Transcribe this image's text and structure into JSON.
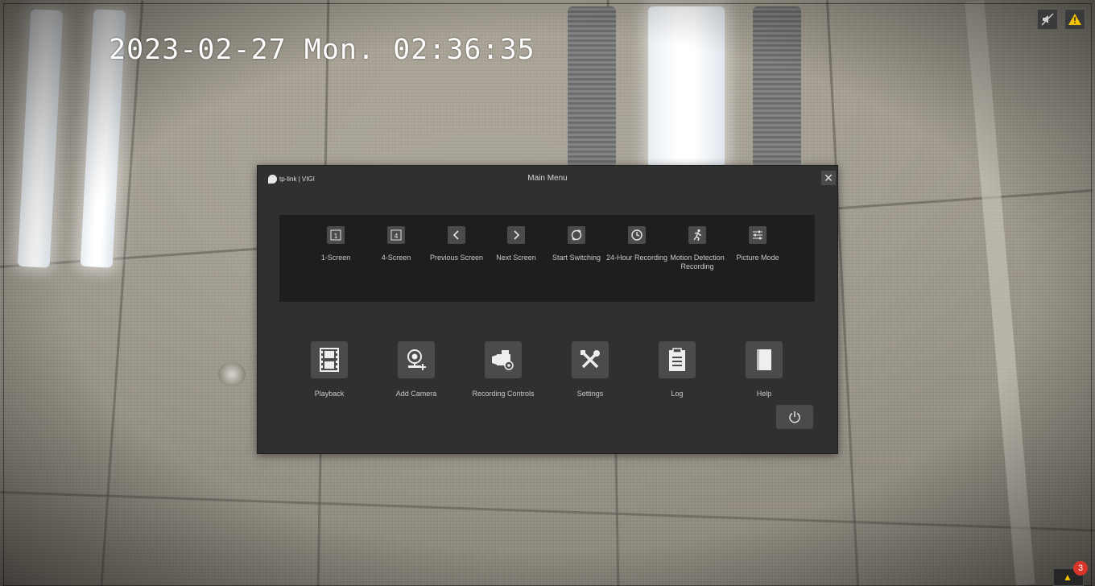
{
  "osd": {
    "timestamp": "2023-02-27 Mon. 02:36:35"
  },
  "status_icons": {
    "mute_icon": "speaker-mute-icon",
    "warning_icon": "warning-icon"
  },
  "alarm": {
    "count": "3",
    "icon": "warning-icon"
  },
  "dialog": {
    "brand": "tp-link | VIGI",
    "title": "Main Menu",
    "close_symbol": "✕",
    "quick_actions": [
      {
        "label": "1-Screen",
        "icon": "one-screen-icon",
        "glyph": "1"
      },
      {
        "label": "4-Screen",
        "icon": "four-screen-icon",
        "glyph": "4"
      },
      {
        "label": "Previous Screen",
        "icon": "chevron-left-icon",
        "glyph": "‹"
      },
      {
        "label": "Next Screen",
        "icon": "chevron-right-icon",
        "glyph": "›"
      },
      {
        "label": "Start Switching",
        "icon": "switching-icon",
        "glyph": "⟳"
      },
      {
        "label": "24-Hour Recording",
        "icon": "clock-icon",
        "glyph": "◷"
      },
      {
        "label": "Motion Detection Recording",
        "icon": "running-person-icon",
        "glyph": "🏃"
      },
      {
        "label": "Picture Mode",
        "icon": "sliders-icon",
        "glyph": "☰"
      }
    ],
    "main_actions": [
      {
        "label": "Playback",
        "icon": "film-icon"
      },
      {
        "label": "Add Camera",
        "icon": "add-camera-icon"
      },
      {
        "label": "Recording Controls",
        "icon": "video-camera-gear-icon"
      },
      {
        "label": "Settings",
        "icon": "tools-icon"
      },
      {
        "label": "Log",
        "icon": "clipboard-icon"
      },
      {
        "label": "Help",
        "icon": "book-icon"
      }
    ],
    "power_icon": "power-icon"
  }
}
